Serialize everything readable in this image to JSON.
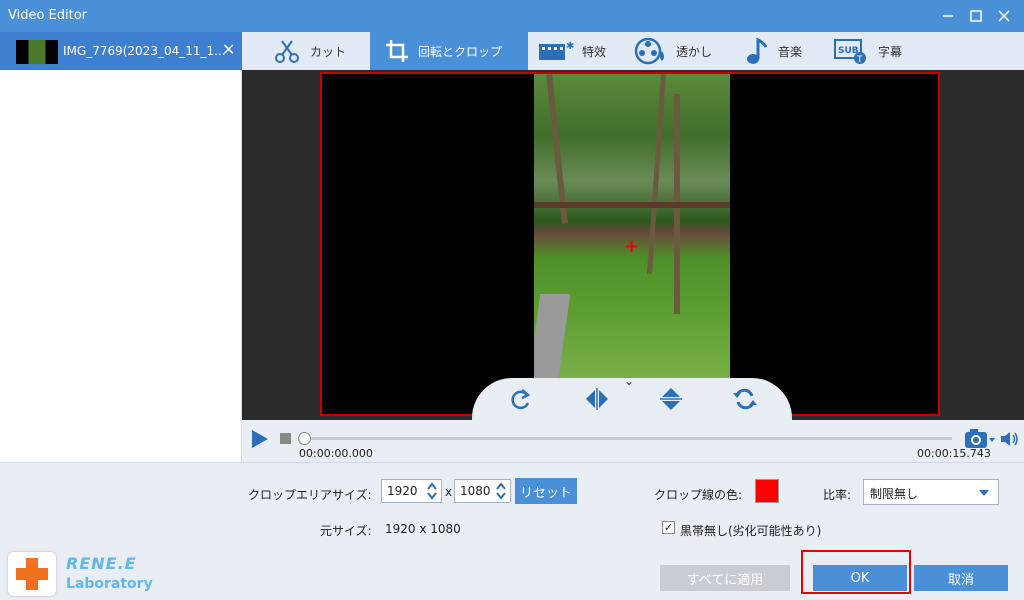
{
  "window": {
    "title": "Video Editor"
  },
  "sidebar": {
    "files": [
      {
        "name": "IMG_7769(2023_04_11_1..."
      }
    ]
  },
  "tabs": [
    {
      "label": "カット",
      "icon": "scissors-icon"
    },
    {
      "label": "回転とクロップ",
      "icon": "crop-icon",
      "active": true
    },
    {
      "label": "特效",
      "icon": "effects-icon"
    },
    {
      "label": "透かし",
      "icon": "watermark-icon"
    },
    {
      "label": "音楽",
      "icon": "music-icon"
    },
    {
      "label": "字幕",
      "icon": "subtitle-icon"
    }
  ],
  "player": {
    "time_current": "00:00:00.000",
    "time_total": "00:00:15.743",
    "progress": 0
  },
  "crop": {
    "area_label": "クロップエリアサイズ:",
    "width": "1920",
    "separator": "x",
    "height": "1080",
    "reset_label": "リセット",
    "original_label": "元サイズ:",
    "original_value": "1920 x 1080",
    "line_color_label": "クロップ線の色:",
    "line_color": "#ff0000",
    "ratio_label": "比率:",
    "ratio_value": "制限無し",
    "black_bars_label": "黒帯無し(劣化可能性あり)",
    "black_bars_checked": true
  },
  "actions": {
    "apply_all": "すべてに適用",
    "ok": "OK",
    "cancel": "取消"
  },
  "logo": {
    "brand": "RENE.E",
    "sub": "Laboratory"
  },
  "colors": {
    "accent": "#4a90d9",
    "active_file": "#3f7fd0",
    "crop_border": "#cc0000"
  }
}
